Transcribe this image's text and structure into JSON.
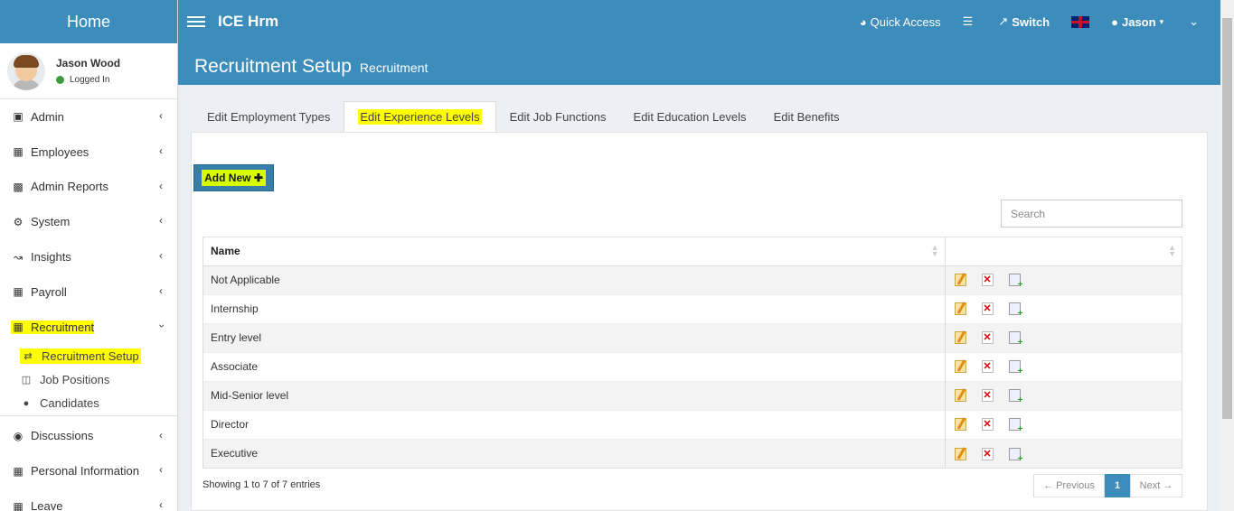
{
  "sidebar": {
    "home_label": "Home",
    "user": {
      "name": "Jason Wood",
      "status": "Logged In"
    },
    "menu": [
      {
        "label": "Admin",
        "icon": "cubes-icon"
      },
      {
        "label": "Employees",
        "icon": "grid-icon"
      },
      {
        "label": "Admin Reports",
        "icon": "reports-icon"
      },
      {
        "label": "System",
        "icon": "gears-icon"
      },
      {
        "label": "Insights",
        "icon": "chart-icon"
      },
      {
        "label": "Payroll",
        "icon": "document-icon"
      },
      {
        "label": "Recruitment",
        "icon": "th-icon"
      }
    ],
    "submenu": [
      {
        "label": "Recruitment Setup",
        "icon": "random-icon"
      },
      {
        "label": "Job Positions",
        "icon": "columns-icon"
      },
      {
        "label": "Candidates",
        "icon": "users-icon"
      }
    ],
    "menu_after": [
      {
        "label": "Discussions",
        "icon": "comments-icon"
      },
      {
        "label": "Personal Information",
        "icon": "grid-icon"
      },
      {
        "label": "Leave",
        "icon": "calendar-icon"
      }
    ]
  },
  "topbar": {
    "app_name": "ICE Hrm",
    "quick_access": "Quick Access",
    "switch": "Switch",
    "user": "Jason"
  },
  "page": {
    "title": "Recruitment Setup",
    "subtitle": "Recruitment"
  },
  "tabs": [
    "Edit Employment Types",
    "Edit Experience Levels",
    "Edit Job Functions",
    "Edit Education Levels",
    "Edit Benefits"
  ],
  "add_new_label": "Add New",
  "search": {
    "placeholder": "Search"
  },
  "table": {
    "header": "Name",
    "rows": [
      "Not Applicable",
      "Internship",
      "Entry level",
      "Associate",
      "Mid-Senior level",
      "Director",
      "Executive"
    ]
  },
  "footer": {
    "info": "Showing 1 to 7 of 7 entries",
    "prev": "← Previous",
    "page": "1",
    "next": "Next →"
  }
}
